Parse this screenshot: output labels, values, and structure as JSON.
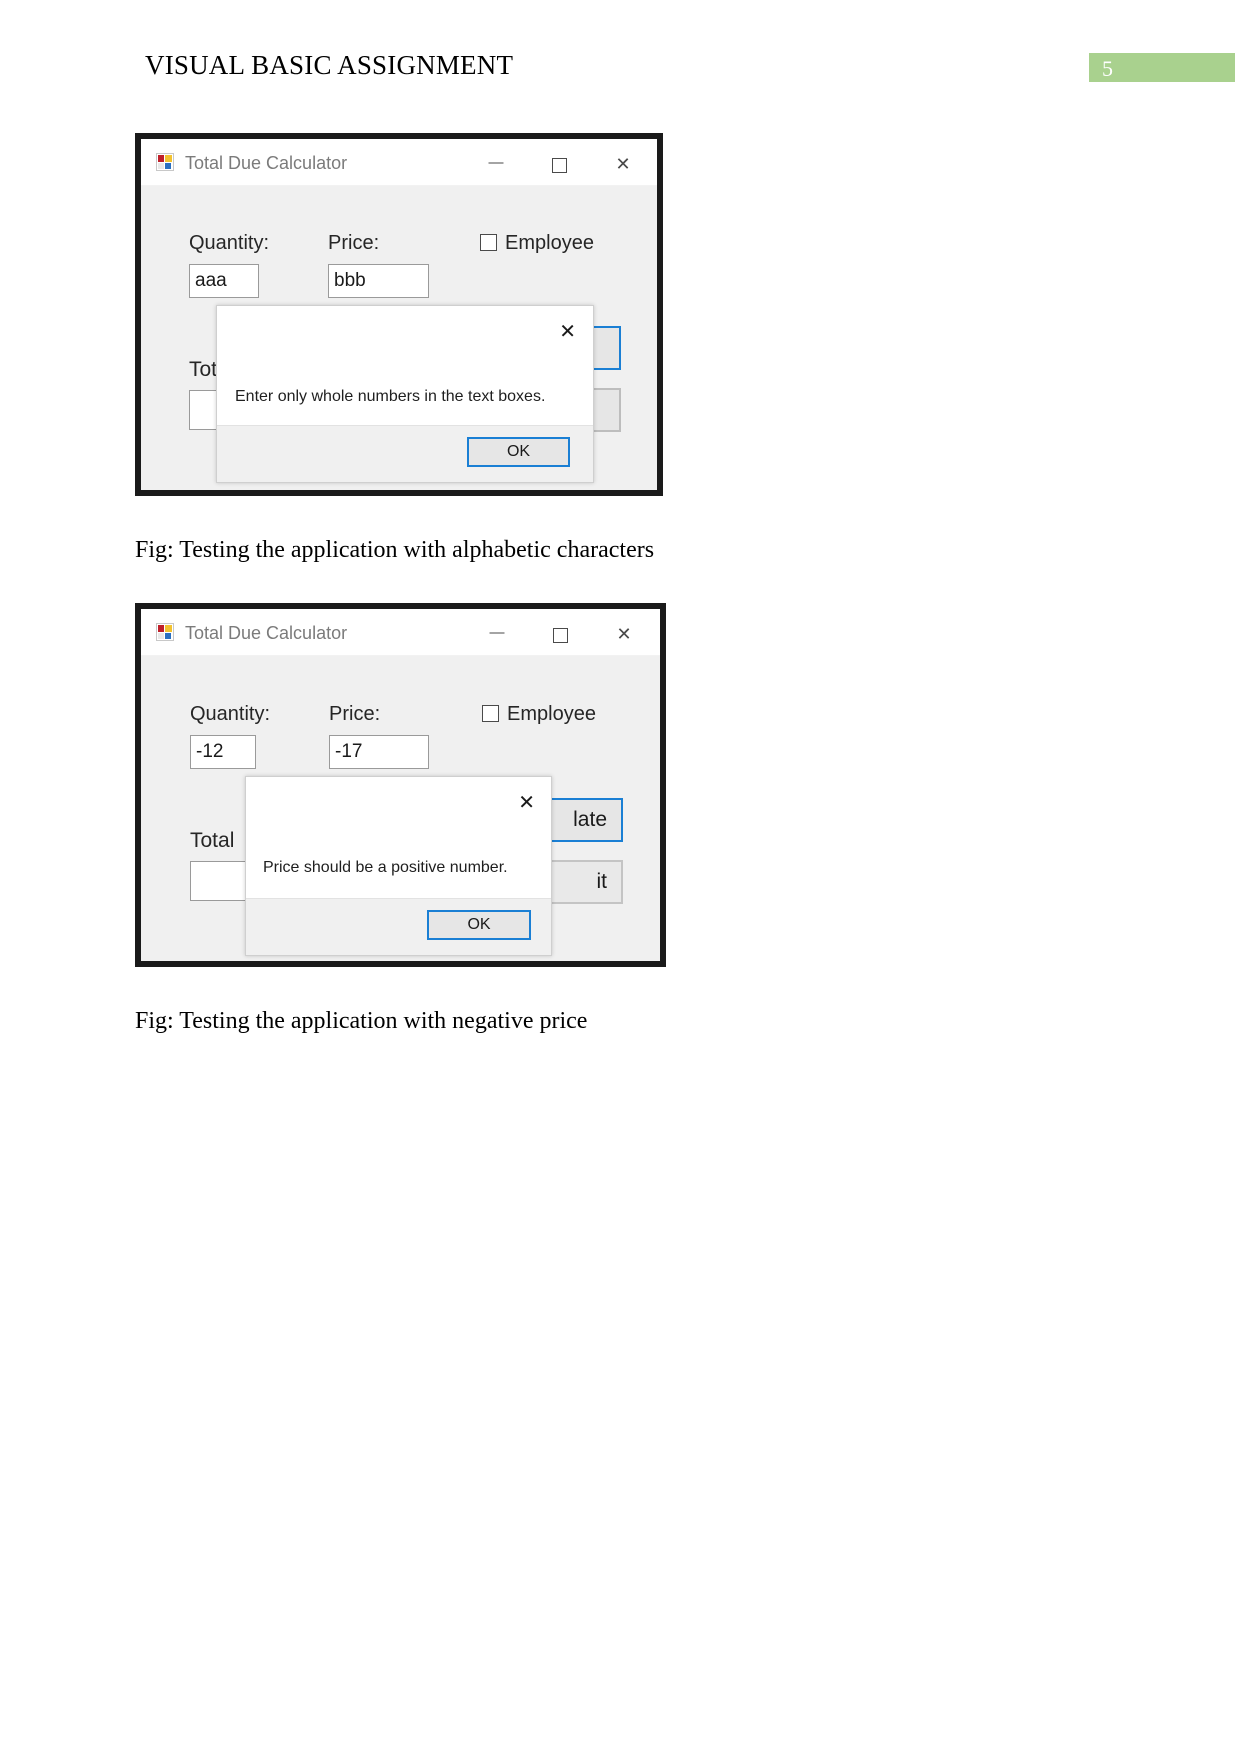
{
  "document": {
    "header_title": "VISUAL BASIC ASSIGNMENT",
    "page_number": "5"
  },
  "theme": {
    "page_badge_color": "#a9d18e",
    "focus_border_color": "#1a7fd4",
    "form_background": "#f0f0f0",
    "screenshot_frame_color": "#1a1a1a"
  },
  "figures": [
    {
      "window": {
        "title": "Total Due Calculator",
        "icon": "vb-app-icon",
        "controls": {
          "minimize": "minimize-icon",
          "maximize": "maximize-icon",
          "close": "close-icon"
        },
        "fields": [
          {
            "label": "Quantity:",
            "value": "aaa"
          },
          {
            "label": "Price:",
            "value": "bbb"
          }
        ],
        "checkbox": {
          "label": "Employee",
          "checked": false
        },
        "total_label": "Tot",
        "buttons": []
      },
      "dialog": {
        "message": "Enter only whole numbers in the text boxes.",
        "ok_label": "OK",
        "close_icon": "close-icon"
      },
      "caption": "Fig: Testing the application with alphabetic characters"
    },
    {
      "window": {
        "title": "Total Due Calculator",
        "icon": "vb-app-icon",
        "controls": {
          "minimize": "minimize-icon",
          "maximize": "maximize-icon",
          "close": "close-icon"
        },
        "fields": [
          {
            "label": "Quantity:",
            "value": "-12"
          },
          {
            "label": "Price:",
            "value": "-17"
          }
        ],
        "checkbox": {
          "label": "Employee",
          "checked": false
        },
        "total_label": "Total",
        "buttons": [
          {
            "label": "late",
            "full_label": "Calculate"
          },
          {
            "label": "it",
            "full_label": "Exit"
          }
        ]
      },
      "dialog": {
        "message": "Price should be a positive number.",
        "ok_label": "OK",
        "close_icon": "close-icon"
      },
      "caption": "Fig: Testing the application with negative price"
    }
  ]
}
